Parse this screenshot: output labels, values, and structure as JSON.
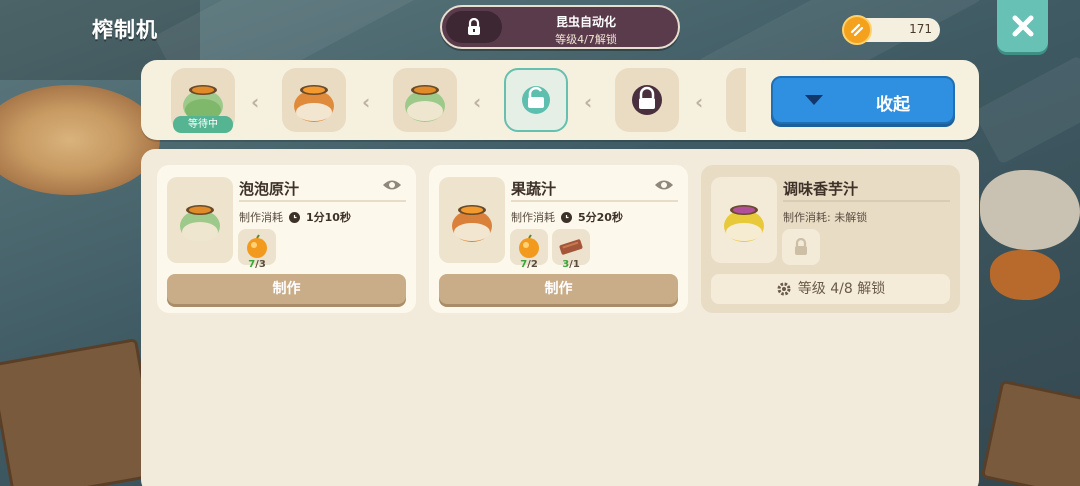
{
  "title": "榨制机",
  "automation": {
    "title": "昆虫自动化",
    "subtitle": "等级4/7解锁"
  },
  "currency": {
    "value": "171",
    "icon": "coin-icon"
  },
  "queue": {
    "waiting_label": "等待中",
    "collapse_label": "收起",
    "slots": [
      {
        "state": "waiting",
        "item": "green-jar"
      },
      {
        "state": "filled",
        "item": "orange-jar"
      },
      {
        "state": "filled",
        "item": "green-jar"
      },
      {
        "state": "unlocked-empty",
        "item": "unlock-icon"
      },
      {
        "state": "locked",
        "item": "lock-icon"
      }
    ]
  },
  "recipes": [
    {
      "name": "泡泡原汁",
      "cost_label": "制作消耗",
      "time": "1分10秒",
      "ingredients": [
        {
          "icon": "orange-fruit-icon",
          "have": "7",
          "need": "3"
        }
      ],
      "action": "制作",
      "jar_color": "green"
    },
    {
      "name": "果蔬汁",
      "cost_label": "制作消耗",
      "time": "5分20秒",
      "ingredients": [
        {
          "icon": "orange-fruit-icon",
          "have": "7",
          "need": "2"
        },
        {
          "icon": "wood-plank-icon",
          "have": "3",
          "need": "1"
        }
      ],
      "action": "制作",
      "jar_color": "orange"
    },
    {
      "name": "调味香芋汁",
      "cost_label": "制作消耗: 未解锁",
      "unlock_text": "等级 4/8 解锁",
      "jar_color": "purple"
    }
  ]
}
